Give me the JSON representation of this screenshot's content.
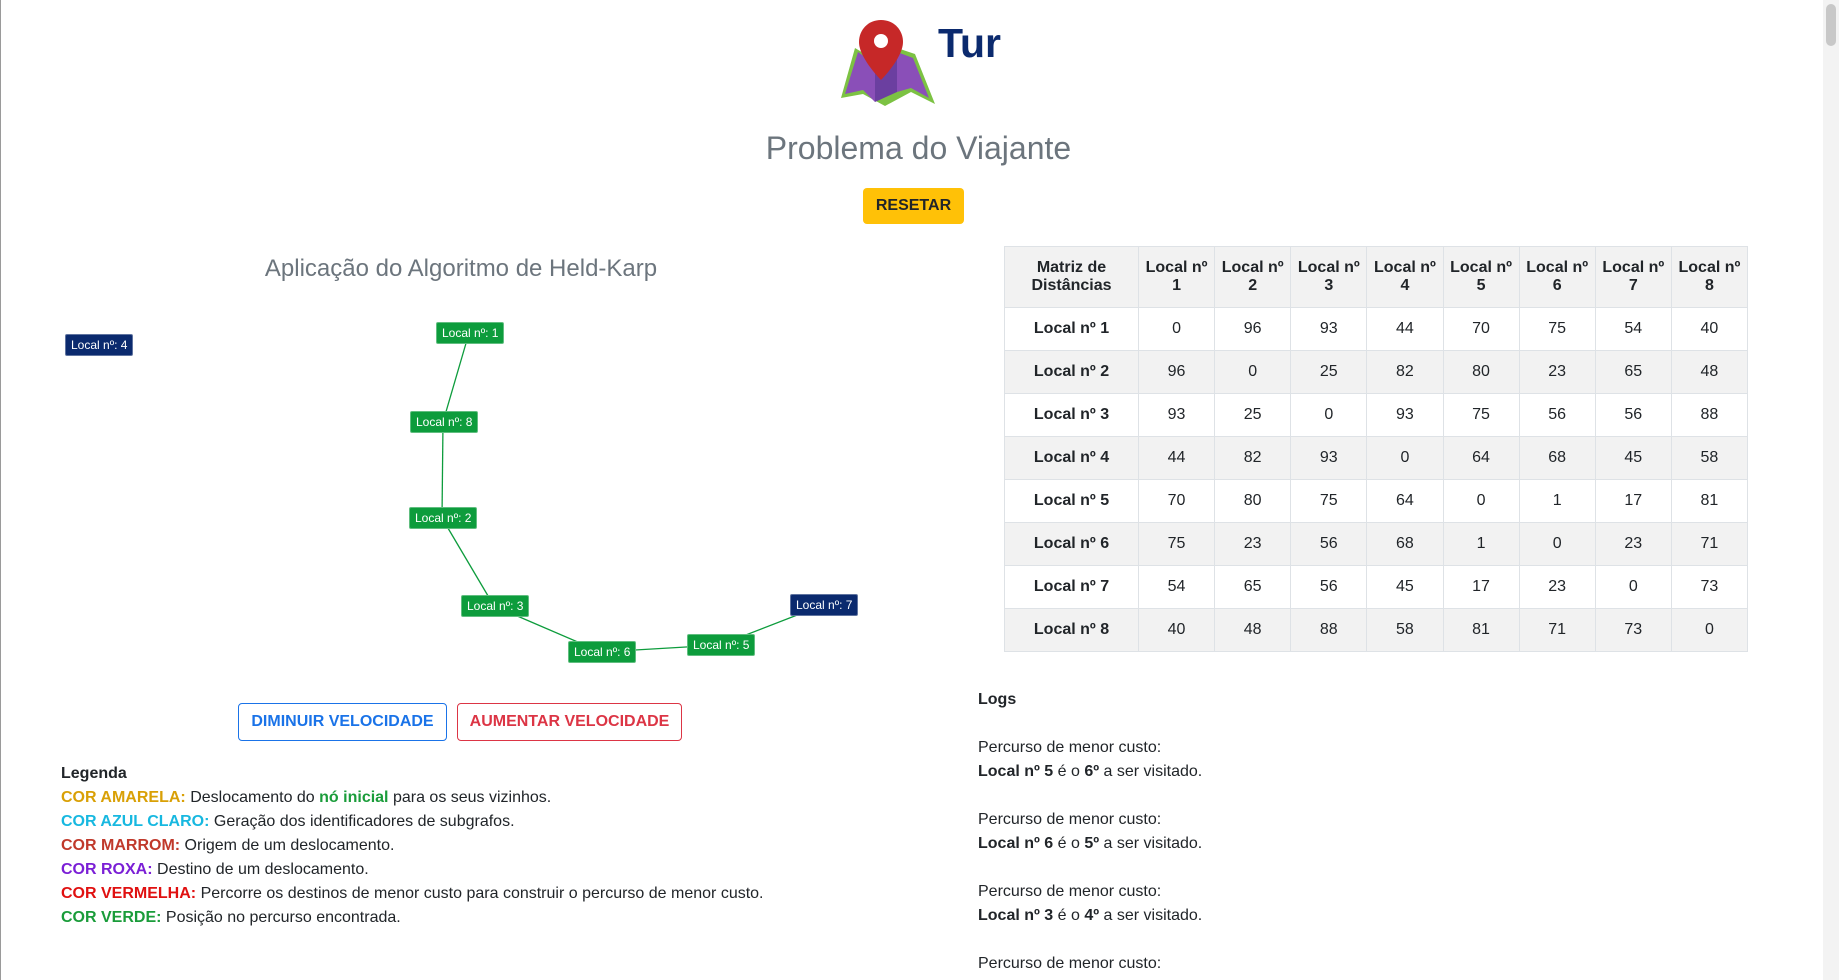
{
  "header": {
    "brand": "Tur",
    "subtitle": "Problema do Viajante",
    "reset_label": "RESETAR"
  },
  "algorithm_title": "Aplicação do Algoritmo de Held-Karp",
  "graph": {
    "nodes": [
      {
        "label": "Local nº: 1",
        "state": "visited"
      },
      {
        "label": "Local nº: 8",
        "state": "visited"
      },
      {
        "label": "Local nº: 2",
        "state": "visited"
      },
      {
        "label": "Local nº: 3",
        "state": "visited"
      },
      {
        "label": "Local nº: 6",
        "state": "visited"
      },
      {
        "label": "Local nº: 5",
        "state": "visited"
      },
      {
        "label": "Local nº: 7",
        "state": "unvisited"
      },
      {
        "label": "Local nº: 4",
        "state": "unvisited"
      }
    ],
    "edges": [
      [
        "Local nº: 1",
        "Local nº: 8"
      ],
      [
        "Local nº: 8",
        "Local nº: 2"
      ],
      [
        "Local nº: 2",
        "Local nº: 3"
      ],
      [
        "Local nº: 3",
        "Local nº: 6"
      ],
      [
        "Local nº: 6",
        "Local nº: 5"
      ],
      [
        "Local nº: 5",
        "Local nº: 7"
      ]
    ],
    "colors": {
      "visited": "#0d9c3c",
      "unvisited": "#0b2a6e",
      "edge": "#0d9c3c"
    }
  },
  "controls": {
    "slower_label": "DIMINUIR VELOCIDADE",
    "faster_label": "AUMENTAR VELOCIDADE"
  },
  "legend": {
    "title": "Legenda",
    "items": [
      {
        "color_name": "COR AMARELA:",
        "text_a": "Deslocamento do ",
        "highlight": "nó inicial",
        "text_b": " para os seus vizinhos."
      },
      {
        "color_name": "COR AZUL CLARO:",
        "text": "Geração dos identificadores de subgrafos."
      },
      {
        "color_name": "COR MARROM:",
        "text": "Origem de um deslocamento."
      },
      {
        "color_name": "COR ROXA:",
        "text": "Destino de um deslocamento."
      },
      {
        "color_name": "COR VERMELHA:",
        "text": "Percorre os destinos de menor custo para construir o percurso de menor custo."
      },
      {
        "color_name": "COR VERDE:",
        "text": "Posição no percurso encontrada."
      }
    ]
  },
  "matrix": {
    "corner": "Matriz de Distâncias",
    "col_headers": [
      "Local nº 1",
      "Local nº 2",
      "Local nº 3",
      "Local nº 4",
      "Local nº 5",
      "Local nº 6",
      "Local nº 7",
      "Local nº 8"
    ],
    "rows": [
      {
        "label": "Local nº 1",
        "values": [
          "0",
          "96",
          "93",
          "44",
          "70",
          "75",
          "54",
          "40"
        ]
      },
      {
        "label": "Local nº 2",
        "values": [
          "96",
          "0",
          "25",
          "82",
          "80",
          "23",
          "65",
          "48"
        ]
      },
      {
        "label": "Local nº 3",
        "values": [
          "93",
          "25",
          "0",
          "93",
          "75",
          "56",
          "56",
          "88"
        ]
      },
      {
        "label": "Local nº 4",
        "values": [
          "44",
          "82",
          "93",
          "0",
          "64",
          "68",
          "45",
          "58"
        ]
      },
      {
        "label": "Local nº 5",
        "values": [
          "70",
          "80",
          "75",
          "64",
          "0",
          "1",
          "17",
          "81"
        ]
      },
      {
        "label": "Local nº 6",
        "values": [
          "75",
          "23",
          "56",
          "68",
          "1",
          "0",
          "23",
          "71"
        ]
      },
      {
        "label": "Local nº 7",
        "values": [
          "54",
          "65",
          "56",
          "45",
          "17",
          "23",
          "0",
          "73"
        ]
      },
      {
        "label": "Local nº 8",
        "values": [
          "40",
          "48",
          "88",
          "58",
          "81",
          "71",
          "73",
          "0"
        ]
      }
    ]
  },
  "logs": {
    "title": "Logs",
    "entries": [
      {
        "heading": "Percurso de menor custo:",
        "local": "Local nº 5",
        "mid": " é o ",
        "position": "6º",
        "tail": " a ser visitado."
      },
      {
        "heading": "Percurso de menor custo:",
        "local": "Local nº 6",
        "mid": " é o ",
        "position": "5º",
        "tail": " a ser visitado."
      },
      {
        "heading": "Percurso de menor custo:",
        "local": "Local nº 3",
        "mid": " é o ",
        "position": "4º",
        "tail": " a ser visitado."
      },
      {
        "heading": "Percurso de menor custo:"
      }
    ]
  }
}
